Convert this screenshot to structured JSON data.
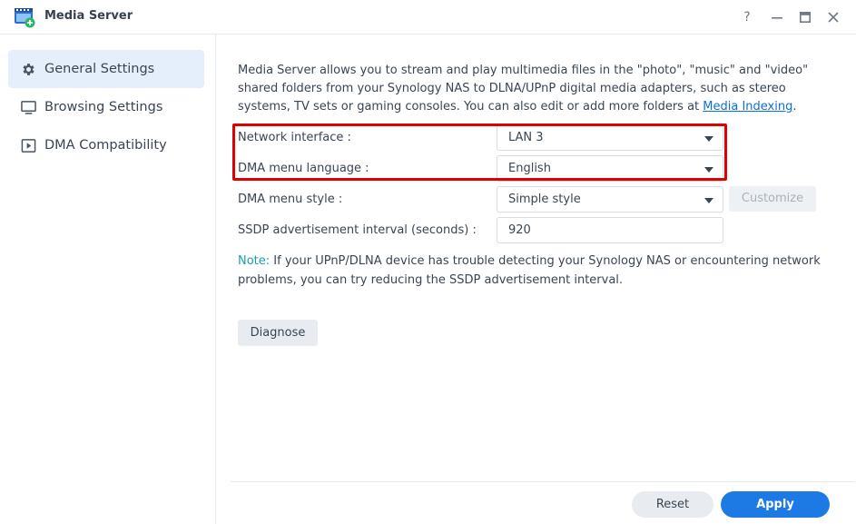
{
  "window": {
    "title": "Media Server",
    "help_label": "?",
    "minimize_label": "—",
    "maximize_label": "▭",
    "close_label": "✕"
  },
  "sidebar": {
    "items": [
      {
        "label": "General Settings",
        "icon": "gear-icon",
        "active": true
      },
      {
        "label": "Browsing Settings",
        "icon": "monitor-icon",
        "active": false
      },
      {
        "label": "DMA Compatibility",
        "icon": "play-box-icon",
        "active": false
      }
    ]
  },
  "main": {
    "description": "Media Server allows you to stream and play multimedia files in the \"photo\", \"music\" and \"video\" shared folders from your Synology NAS to DLNA/UPnP digital media adapters, such as stereo systems, TV sets or gaming consoles. You can also edit or add more folders at ",
    "description_link": "Media Indexing",
    "description_end": ".",
    "network_interface": {
      "label": "Network interface :",
      "value": "LAN 3"
    },
    "dma_menu_language": {
      "label": "DMA menu language :",
      "value": "English"
    },
    "dma_menu_style": {
      "label": "DMA menu style :",
      "value": "Simple style",
      "customize_label": "Customize"
    },
    "ssdp_interval": {
      "label": "SSDP advertisement interval (seconds) :",
      "value": "920"
    },
    "note_label": "Note:",
    "note_text": " If your UPnP/DLNA device has trouble detecting your Synology NAS or encountering network problems, you can try reducing the SSDP advertisement interval.",
    "diagnose_label": "Diagnose"
  },
  "footer": {
    "reset_label": "Reset",
    "apply_label": "Apply"
  },
  "colors": {
    "accent": "#1d7ae4",
    "highlight": "#e00000",
    "note": "#1aa0a8",
    "link": "#0a6fd6"
  }
}
